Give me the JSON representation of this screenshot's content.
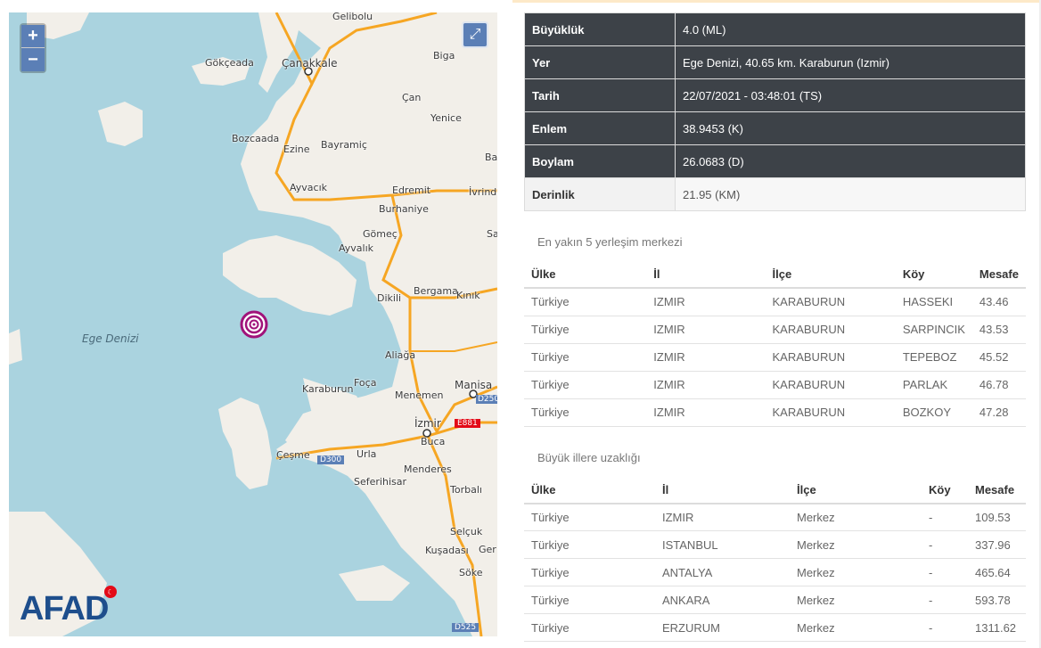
{
  "map": {
    "zoom_in": "+",
    "zoom_out": "−",
    "fullscreen_glyph": "⤢",
    "brand": "AFAD",
    "labels": {
      "sea": "Ege Denizi",
      "gelibolu": "Gelibolu",
      "canakkale": "Çanakkale",
      "gokceada": "Gökçeada",
      "biga": "Biga",
      "can": "Çan",
      "yenice": "Yenice",
      "bozcaada": "Bozcaada",
      "ezine": "Ezine",
      "bayramic": "Bayramiç",
      "ba": "Ba",
      "ayvacik": "Ayvacık",
      "edremit": "Edremit",
      "ivrindi": "İvrindi",
      "burhaniye": "Burhaniye",
      "gomec": "Gömeç",
      "ayvalik": "Ayvalık",
      "sa": "Sa",
      "dikili": "Dikili",
      "bergama": "Bergama",
      "kinik": "Kınık",
      "aliaga": "Aliağa",
      "foca": "Foça",
      "karaburun": "Karaburun",
      "menemen": "Menemen",
      "manisa": "Manisa",
      "d250": "D250",
      "izmir": "İzmir",
      "e881": "E881",
      "buca": "Buca",
      "cesme": "Çeşme",
      "d300": "D300",
      "urla": "Urla",
      "menderes": "Menderes",
      "seferihisar": "Seferihisar",
      "torbali": "Torbalı",
      "selcuk": "Selçuk",
      "kusadasi": "Kuşadası",
      "ger": "Ger",
      "soke": "Söke",
      "d525": "D525"
    }
  },
  "info": [
    {
      "key": "Büyüklük",
      "value": "4.0 (ML)"
    },
    {
      "key": "Yer",
      "value": "Ege Denizi, 40.65 km. Karaburun (Izmir)"
    },
    {
      "key": "Tarih",
      "value": "22/07/2021 - 03:48:01 (TS)"
    },
    {
      "key": "Enlem",
      "value": "38.9453 (K)"
    },
    {
      "key": "Boylam",
      "value": "26.0683 (D)"
    },
    {
      "key": "Derinlik",
      "value": "21.95 (KM)"
    }
  ],
  "nearest": {
    "title": "En yakın 5 yerleşim merkezi",
    "headers": [
      "Ülke",
      "İl",
      "İlçe",
      "Köy",
      "Mesafe"
    ],
    "rows": [
      [
        "Türkiye",
        "IZMIR",
        "KARABURUN",
        "HASSEKI",
        "43.46"
      ],
      [
        "Türkiye",
        "IZMIR",
        "KARABURUN",
        "SARPINCIK",
        "43.53"
      ],
      [
        "Türkiye",
        "IZMIR",
        "KARABURUN",
        "TEPEBOZ",
        "45.52"
      ],
      [
        "Türkiye",
        "IZMIR",
        "KARABURUN",
        "PARLAK",
        "46.78"
      ],
      [
        "Türkiye",
        "IZMIR",
        "KARABURUN",
        "BOZKOY",
        "47.28"
      ]
    ]
  },
  "cities": {
    "title": "Büyük illere uzaklığı",
    "headers": [
      "Ülke",
      "İl",
      "İlçe",
      "Köy",
      "Mesafe"
    ],
    "rows": [
      [
        "Türkiye",
        "IZMIR",
        "Merkez",
        "-",
        "109.53"
      ],
      [
        "Türkiye",
        "ISTANBUL",
        "Merkez",
        "-",
        "337.96"
      ],
      [
        "Türkiye",
        "ANTALYA",
        "Merkez",
        "-",
        "465.64"
      ],
      [
        "Türkiye",
        "ANKARA",
        "Merkez",
        "-",
        "593.78"
      ],
      [
        "Türkiye",
        "ERZURUM",
        "Merkez",
        "-",
        "1311.62"
      ]
    ]
  },
  "colors": {
    "header_dark": "#3d4248",
    "sea": "#aad3df",
    "land": "#f2efe9",
    "road": "#f6a623",
    "epicenter": "#a0137a"
  }
}
